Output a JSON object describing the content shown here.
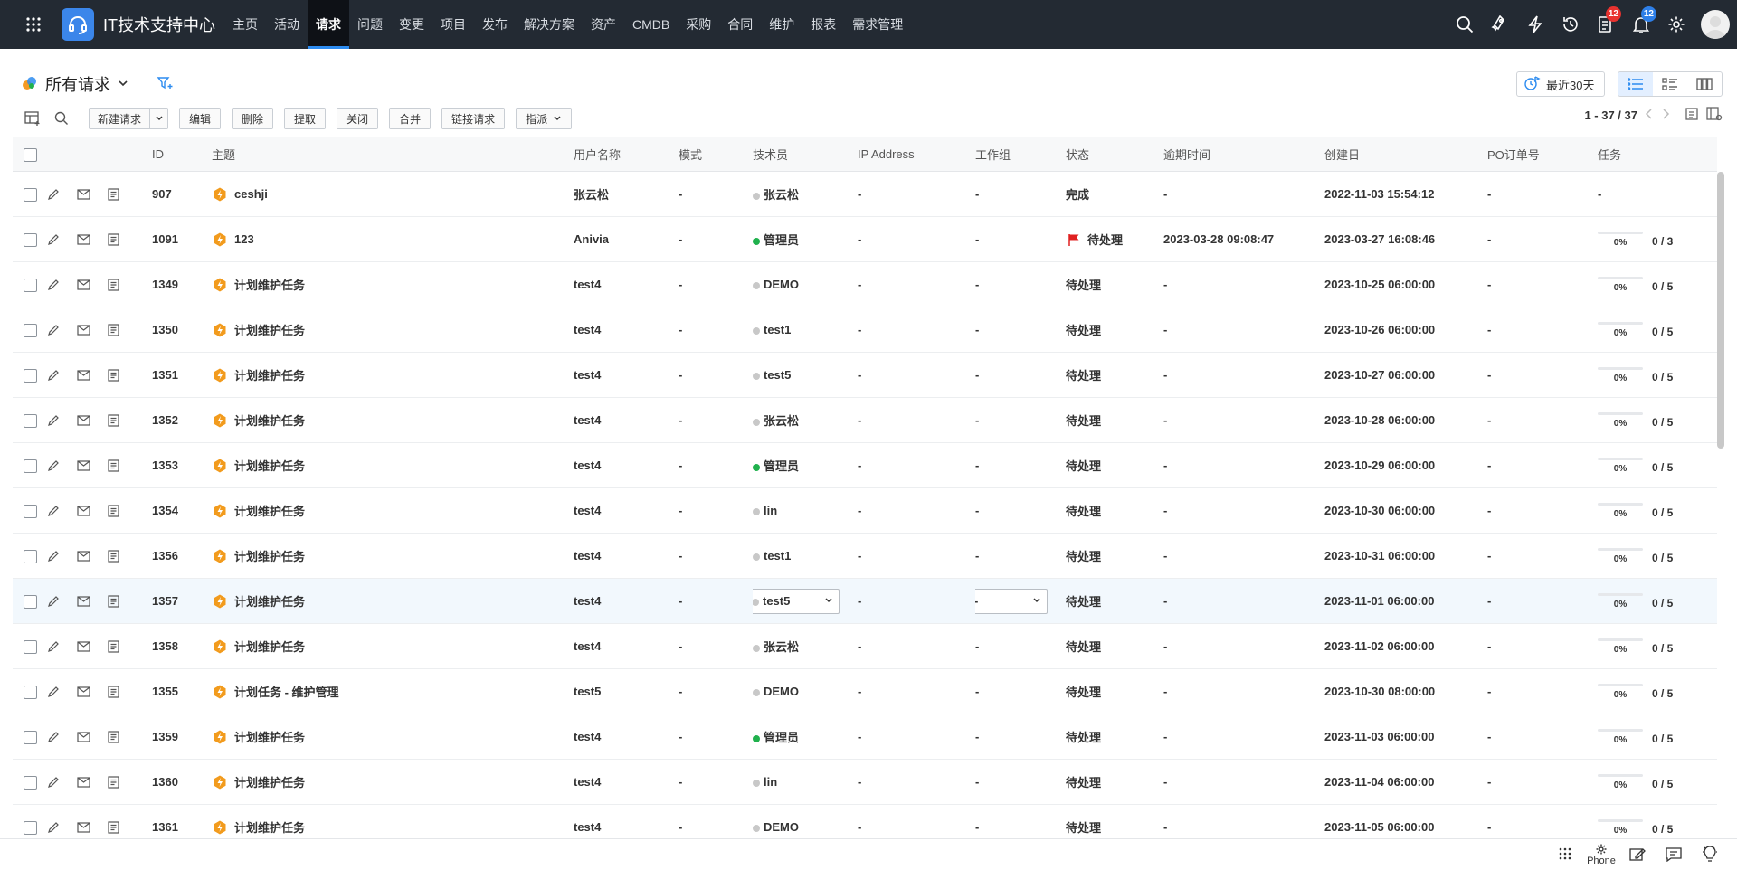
{
  "app": {
    "title": "IT技术支持中心",
    "nav": [
      "主页",
      "活动",
      "请求",
      "问题",
      "变更",
      "项目",
      "发布",
      "解决方案",
      "资产",
      "CMDB",
      "采购",
      "合同",
      "维护",
      "报表",
      "需求管理"
    ],
    "active_nav": "请求",
    "notifications": {
      "tasks_badge": "12",
      "bell_badge": "12"
    },
    "colors": {
      "topbar": "#232a33",
      "accent": "#2d8cf0",
      "badge_red": "#e8322f",
      "badge_blue": "#2e7fe8"
    }
  },
  "view": {
    "title": "所有请求",
    "range_label": "最近30天"
  },
  "toolbar": {
    "buttons": [
      "新建请求",
      "编辑",
      "删除",
      "提取",
      "关闭",
      "合并",
      "链接请求",
      "指派"
    ],
    "pager": "1 - 37 / 37"
  },
  "table": {
    "columns": [
      "ID",
      "主题",
      "用户名称",
      "模式",
      "技术员",
      "IP Address",
      "工作组",
      "状态",
      "逾期时间",
      "创建日",
      "PO订单号",
      "任务"
    ],
    "rows": [
      {
        "id": "907",
        "subject": "ceshji",
        "user": "张云松",
        "mode": "-",
        "tech": "张云松",
        "tech_online": false,
        "ip": "-",
        "group": "-",
        "status": "完成",
        "overdue": "-",
        "created": "2022-11-03 15:54:12",
        "po": "-",
        "task_pct": "",
        "task_count": "-"
      },
      {
        "id": "1091",
        "subject": "123",
        "user": "Anivia",
        "mode": "-",
        "tech": "管理员",
        "tech_online": true,
        "ip": "-",
        "group": "-",
        "status": "待处理",
        "overdue": "2023-03-28 09:08:47",
        "created": "2023-03-27 16:08:46",
        "po": "-",
        "task_pct": "0%",
        "task_count": "0 / 3",
        "flagged": true
      },
      {
        "id": "1349",
        "subject": "计划维护任务",
        "user": "test4",
        "mode": "-",
        "tech": "DEMO",
        "tech_online": false,
        "ip": "-",
        "group": "-",
        "status": "待处理",
        "overdue": "-",
        "created": "2023-10-25 06:00:00",
        "po": "-",
        "task_pct": "0%",
        "task_count": "0 / 5"
      },
      {
        "id": "1350",
        "subject": "计划维护任务",
        "user": "test4",
        "mode": "-",
        "tech": "test1",
        "tech_online": false,
        "ip": "-",
        "group": "-",
        "status": "待处理",
        "overdue": "-",
        "created": "2023-10-26 06:00:00",
        "po": "-",
        "task_pct": "0%",
        "task_count": "0 / 5"
      },
      {
        "id": "1351",
        "subject": "计划维护任务",
        "user": "test4",
        "mode": "-",
        "tech": "test5",
        "tech_online": false,
        "ip": "-",
        "group": "-",
        "status": "待处理",
        "overdue": "-",
        "created": "2023-10-27 06:00:00",
        "po": "-",
        "task_pct": "0%",
        "task_count": "0 / 5"
      },
      {
        "id": "1352",
        "subject": "计划维护任务",
        "user": "test4",
        "mode": "-",
        "tech": "张云松",
        "tech_online": false,
        "ip": "-",
        "group": "-",
        "status": "待处理",
        "overdue": "-",
        "created": "2023-10-28 06:00:00",
        "po": "-",
        "task_pct": "0%",
        "task_count": "0 / 5"
      },
      {
        "id": "1353",
        "subject": "计划维护任务",
        "user": "test4",
        "mode": "-",
        "tech": "管理员",
        "tech_online": true,
        "ip": "-",
        "group": "-",
        "status": "待处理",
        "overdue": "-",
        "created": "2023-10-29 06:00:00",
        "po": "-",
        "task_pct": "0%",
        "task_count": "0 / 5"
      },
      {
        "id": "1354",
        "subject": "计划维护任务",
        "user": "test4",
        "mode": "-",
        "tech": "lin",
        "tech_online": false,
        "ip": "-",
        "group": "-",
        "status": "待处理",
        "overdue": "-",
        "created": "2023-10-30 06:00:00",
        "po": "-",
        "task_pct": "0%",
        "task_count": "0 / 5"
      },
      {
        "id": "1356",
        "subject": "计划维护任务",
        "user": "test4",
        "mode": "-",
        "tech": "test1",
        "tech_online": false,
        "ip": "-",
        "group": "-",
        "status": "待处理",
        "overdue": "-",
        "created": "2023-10-31 06:00:00",
        "po": "-",
        "task_pct": "0%",
        "task_count": "0 / 5"
      },
      {
        "id": "1357",
        "subject": "计划维护任务",
        "user": "test4",
        "mode": "-",
        "tech": "test5",
        "tech_online": false,
        "ip": "-",
        "group": "-",
        "status": "待处理",
        "overdue": "-",
        "created": "2023-11-01 06:00:00",
        "po": "-",
        "task_pct": "0%",
        "task_count": "0 / 5",
        "editing": true
      },
      {
        "id": "1358",
        "subject": "计划维护任务",
        "user": "test4",
        "mode": "-",
        "tech": "张云松",
        "tech_online": false,
        "ip": "-",
        "group": "-",
        "status": "待处理",
        "overdue": "-",
        "created": "2023-11-02 06:00:00",
        "po": "-",
        "task_pct": "0%",
        "task_count": "0 / 5"
      },
      {
        "id": "1355",
        "subject": "计划任务 - 维护管理",
        "user": "test5",
        "mode": "-",
        "tech": "DEMO",
        "tech_online": false,
        "ip": "-",
        "group": "-",
        "status": "待处理",
        "overdue": "-",
        "created": "2023-10-30 08:00:00",
        "po": "-",
        "task_pct": "0%",
        "task_count": "0 / 5"
      },
      {
        "id": "1359",
        "subject": "计划维护任务",
        "user": "test4",
        "mode": "-",
        "tech": "管理员",
        "tech_online": true,
        "ip": "-",
        "group": "-",
        "status": "待处理",
        "overdue": "-",
        "created": "2023-11-03 06:00:00",
        "po": "-",
        "task_pct": "0%",
        "task_count": "0 / 5"
      },
      {
        "id": "1360",
        "subject": "计划维护任务",
        "user": "test4",
        "mode": "-",
        "tech": "lin",
        "tech_online": false,
        "ip": "-",
        "group": "-",
        "status": "待处理",
        "overdue": "-",
        "created": "2023-11-04 06:00:00",
        "po": "-",
        "task_pct": "0%",
        "task_count": "0 / 5"
      },
      {
        "id": "1361",
        "subject": "计划维护任务",
        "user": "test4",
        "mode": "-",
        "tech": "DEMO",
        "tech_online": false,
        "ip": "-",
        "group": "-",
        "status": "待处理",
        "overdue": "-",
        "created": "2023-11-05 06:00:00",
        "po": "-",
        "task_pct": "0%",
        "task_count": "0 / 5"
      }
    ]
  },
  "bottombar": {
    "phone_label": "Phone"
  }
}
